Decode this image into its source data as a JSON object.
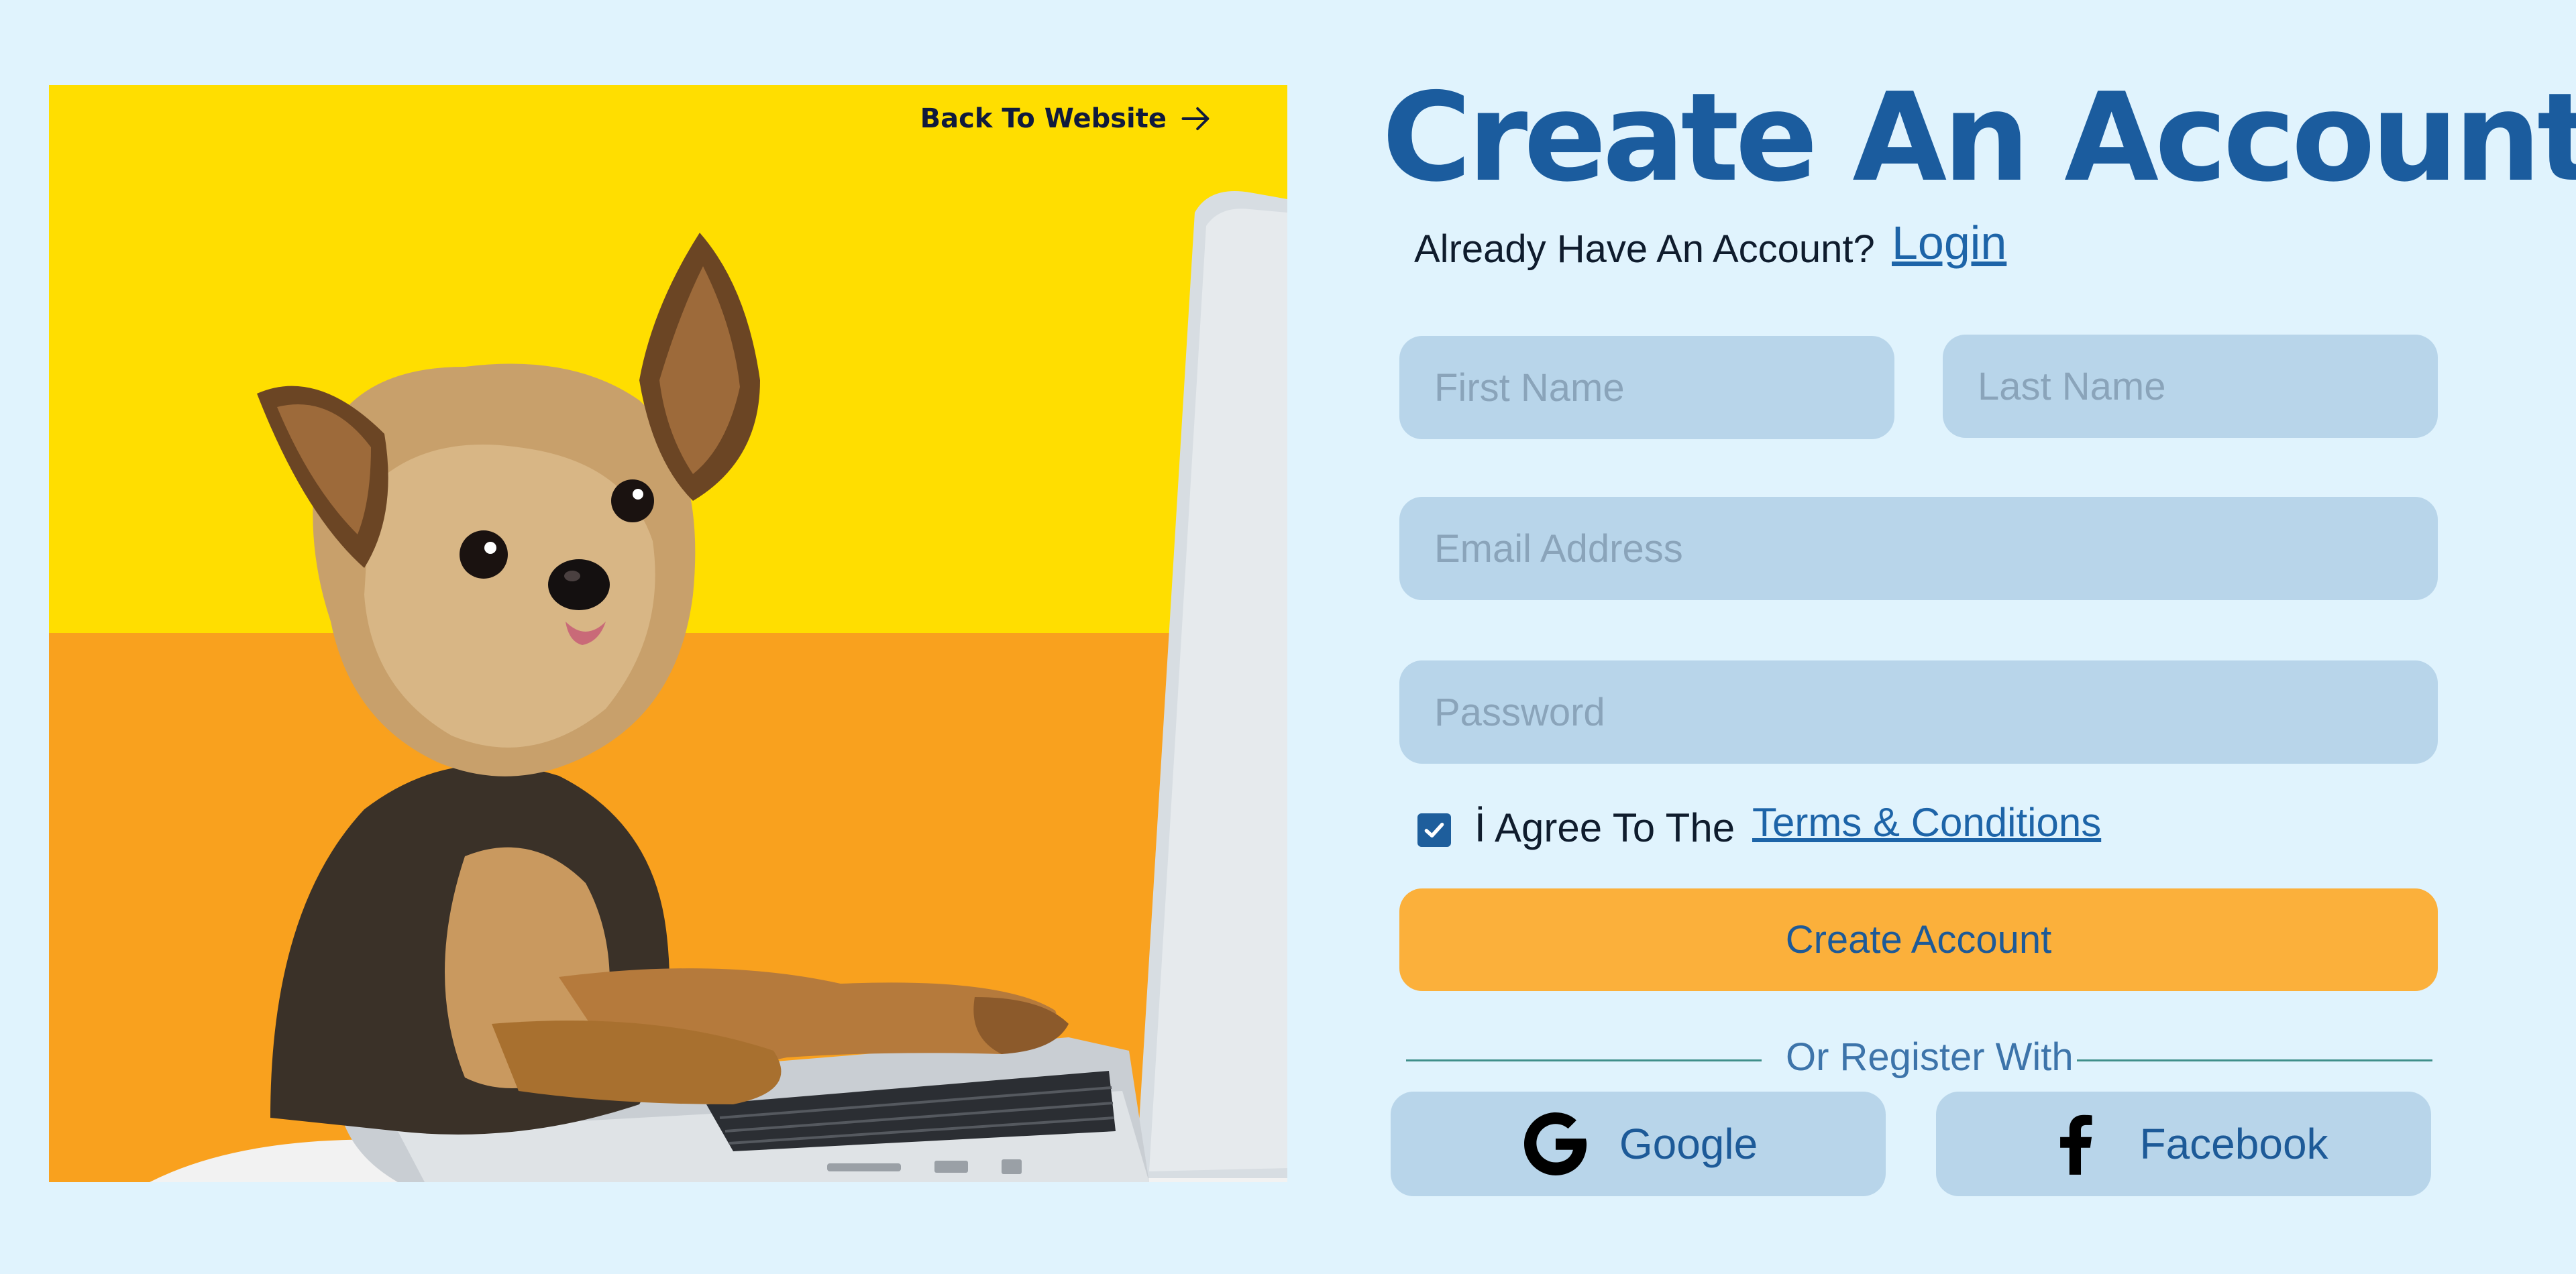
{
  "hero": {
    "back_label": "Back To Website",
    "colors": {
      "top": "#ffde00",
      "bottom": "#f9a11e"
    }
  },
  "form": {
    "title": "Create An Account",
    "already_text": "Already Have An Account?",
    "login_label": "Login",
    "first_name_placeholder": "First Name",
    "last_name_placeholder": "Last Name",
    "email_placeholder": "Email Address",
    "password_placeholder": "Password",
    "agree_text": "İ Agree To The",
    "terms_label": "Terms & Conditions",
    "terms_checked": true,
    "submit_label": "Create Account",
    "or_text": "Or Register With",
    "google_label": "Google",
    "facebook_label": "Facebook"
  },
  "colors": {
    "background": "#e0f3fd",
    "primary": "#1b5c9e",
    "input_bg": "#b8d5ea",
    "accent": "#fbb03b"
  },
  "icons": {
    "back": "arrow-right-icon",
    "check": "checkmark-icon",
    "google": "google-icon",
    "facebook": "facebook-icon"
  }
}
